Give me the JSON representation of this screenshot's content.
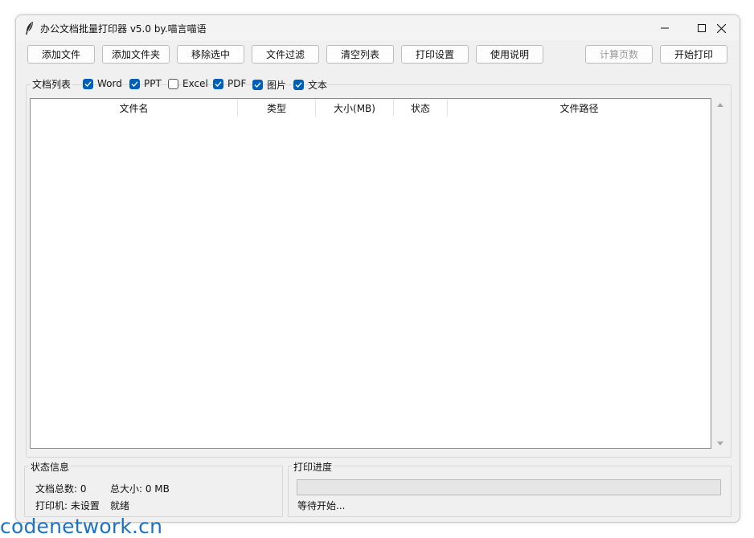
{
  "window": {
    "title": "办公文档批量打印器 v5.0 by.喵言喵语",
    "controls": [
      "minimize",
      "maximize",
      "close"
    ]
  },
  "toolbar": {
    "add_file": "添加文件",
    "add_folder": "添加文件夹",
    "remove_selected": "移除选中",
    "file_filter": "文件过滤",
    "clear_list": "清空列表",
    "print_settings": "打印设置",
    "help": "使用说明",
    "count_pages": "计算页数",
    "start_print": "开始打印"
  },
  "filters": {
    "label": "文档列表",
    "items": [
      {
        "label": "Word",
        "checked": true
      },
      {
        "label": "PPT",
        "checked": true
      },
      {
        "label": "Excel",
        "checked": false
      },
      {
        "label": "PDF",
        "checked": true
      },
      {
        "label": "图片",
        "checked": true
      },
      {
        "label": "文本",
        "checked": true
      }
    ]
  },
  "table": {
    "columns": [
      "文件名",
      "类型",
      "大小(MB)",
      "状态",
      "文件路径"
    ],
    "rows": []
  },
  "status": {
    "group_label": "状态信息",
    "doc_count": "文档总数: 0",
    "total_size": "总大小: 0 MB",
    "printer": "打印机: 未设置",
    "state": "就绪"
  },
  "progress": {
    "group_label": "打印进度",
    "value": 0,
    "text": "等待开始..."
  },
  "watermark": "codenetwork.cn",
  "colors": {
    "accent": "#005fb8",
    "window_bg": "#f0f0f0",
    "watermark": "#1a73c8"
  },
  "icons": {
    "app": "feather-icon",
    "minimize": "minimize-icon",
    "maximize": "maximize-icon",
    "close": "close-icon",
    "check": "checkmark-icon"
  }
}
